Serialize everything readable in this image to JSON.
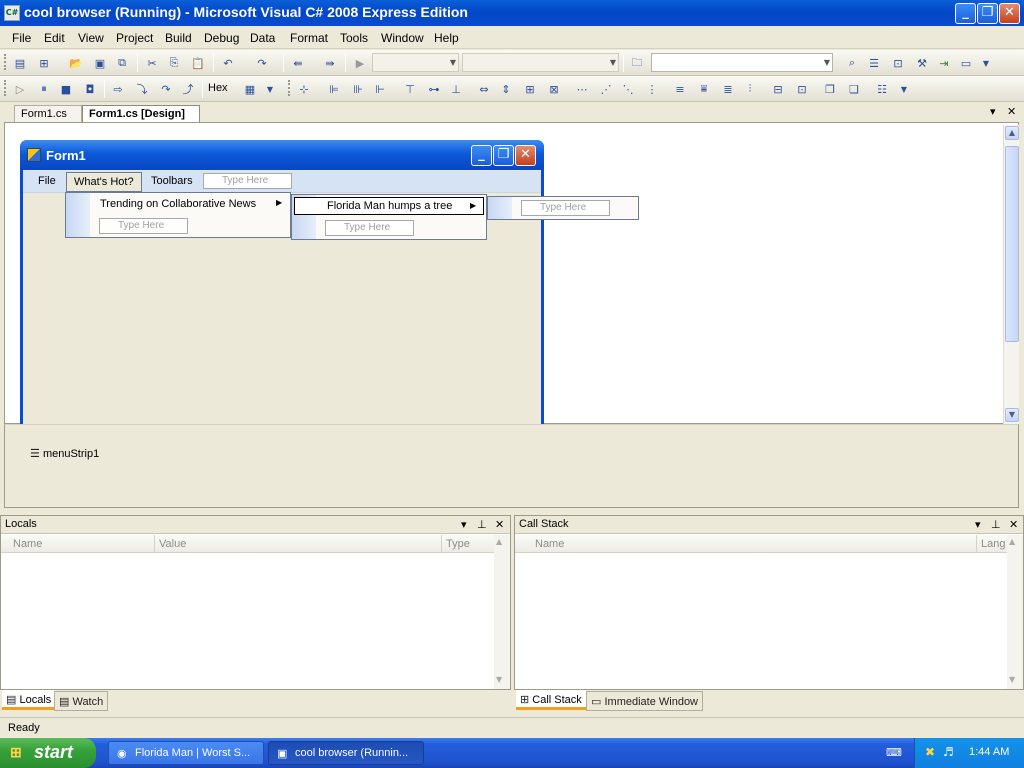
{
  "window": {
    "title": "cool browser (Running) - Microsoft Visual C# 2008 Express Edition",
    "icon": "visual-csharp-icon",
    "caption_buttons": {
      "minimize": "_",
      "restore": "❐",
      "close": "✕"
    }
  },
  "menubar": {
    "items": [
      "File",
      "Edit",
      "View",
      "Project",
      "Build",
      "Debug",
      "Data",
      "Format",
      "Tools",
      "Window",
      "Help"
    ]
  },
  "toolbar2": {
    "hex_label": "Hex"
  },
  "doc_tabs": [
    {
      "label": "Form1.cs",
      "active": false
    },
    {
      "label": "Form1.cs [Design]",
      "active": true
    }
  ],
  "doc_tab_controls": {
    "dropdown": "▾",
    "close": "✕"
  },
  "form1": {
    "title": "Form1",
    "menu": {
      "items": [
        "File",
        "What's Hot?",
        "Toolbars"
      ],
      "type_here": "Type Here"
    },
    "dropdown_level1": {
      "item": "Trending on Collaborative News",
      "type_here": "Type Here"
    },
    "dropdown_level2": {
      "item": "Florida Man humps a tree",
      "type_here": "Type Here"
    },
    "dropdown_level3": {
      "type_here": "Type Here"
    }
  },
  "component_tray": {
    "component": "menuStrip1"
  },
  "locals_pane": {
    "title": "Locals",
    "columns": [
      "Name",
      "Value",
      "Type"
    ],
    "tabs": [
      "Locals",
      "Watch"
    ]
  },
  "callstack_pane": {
    "title": "Call Stack",
    "columns": [
      "Name",
      "Lang"
    ],
    "tabs": [
      "Call Stack",
      "Immediate Window"
    ]
  },
  "pane_controls": {
    "dropdown": "▾",
    "pin": "⊥",
    "close": "✕"
  },
  "status": {
    "text": "Ready"
  },
  "taskbar": {
    "start_label": "start",
    "buttons": [
      {
        "label": "Florida Man | Worst S...",
        "active": false
      },
      {
        "label": "cool browser (Runnin...",
        "active": true
      }
    ],
    "clock": "1:44 AM"
  },
  "colors": {
    "xp_blue": "#0a4bd0",
    "menu_blue": "#d6e3f5",
    "chrome": "#ece9d8"
  }
}
